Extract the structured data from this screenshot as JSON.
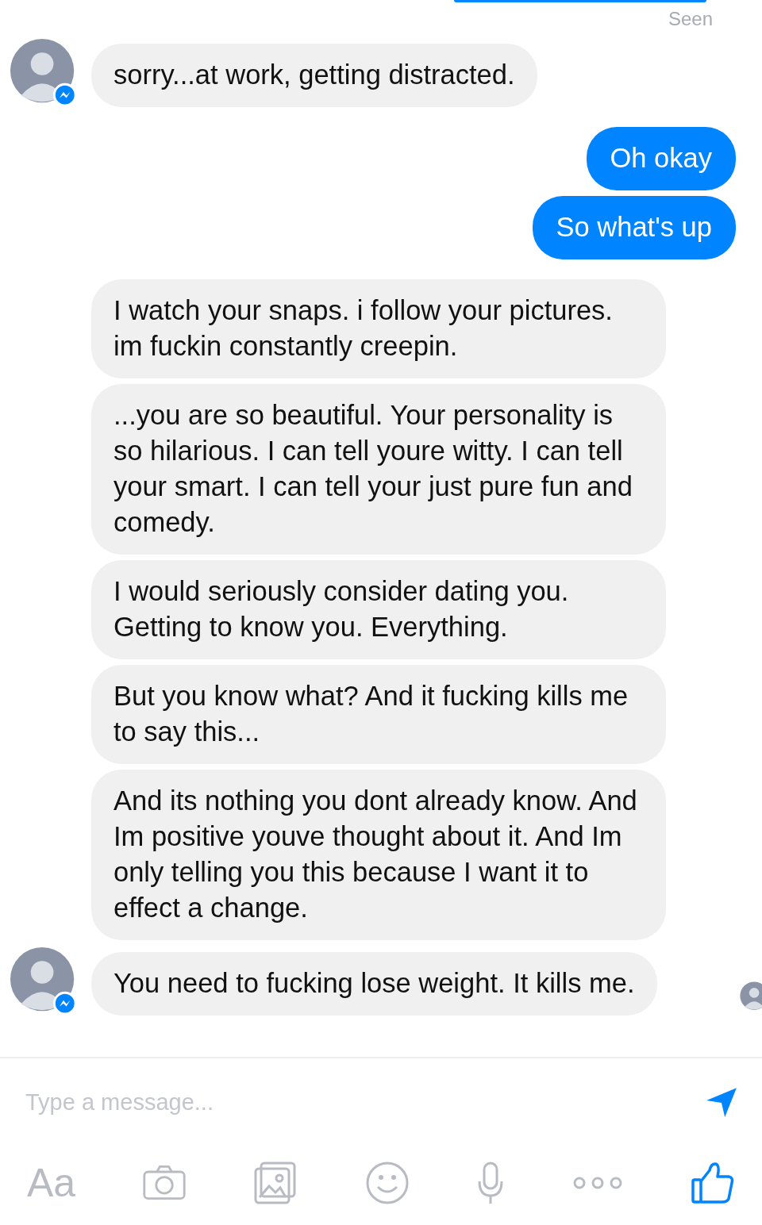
{
  "seen_label": "Seen",
  "messages": [
    {
      "kind": "incoming",
      "avatar": true,
      "text": "sorry...at work, getting distracted."
    },
    {
      "kind": "outgoing",
      "text": "Oh okay"
    },
    {
      "kind": "outgoing",
      "text": "So what's up"
    },
    {
      "kind": "incoming",
      "avatar": false,
      "text": "I watch your snaps. i follow your pictures. im fuckin constantly creepin."
    },
    {
      "kind": "incoming",
      "avatar": false,
      "text": "...you are so beautiful. Your personality is so hilarious. I can tell youre witty. I can tell your smart. I can tell your just pure fun and comedy."
    },
    {
      "kind": "incoming",
      "avatar": false,
      "text": "I would seriously consider dating you. Getting to know you. Everything."
    },
    {
      "kind": "incoming",
      "avatar": false,
      "text": "But you know what? And it fucking kills me to say this..."
    },
    {
      "kind": "incoming",
      "avatar": false,
      "text": "And its nothing you dont already know. And Im positive youve thought about it. And Im only telling you this because I want it to effect a change."
    },
    {
      "kind": "incoming",
      "avatar": true,
      "read_receipt": true,
      "text": "You need to fucking lose weight. It kills me."
    }
  ],
  "composer": {
    "placeholder": "Type a message..."
  },
  "toolbar": {
    "text_button": "Aa"
  }
}
